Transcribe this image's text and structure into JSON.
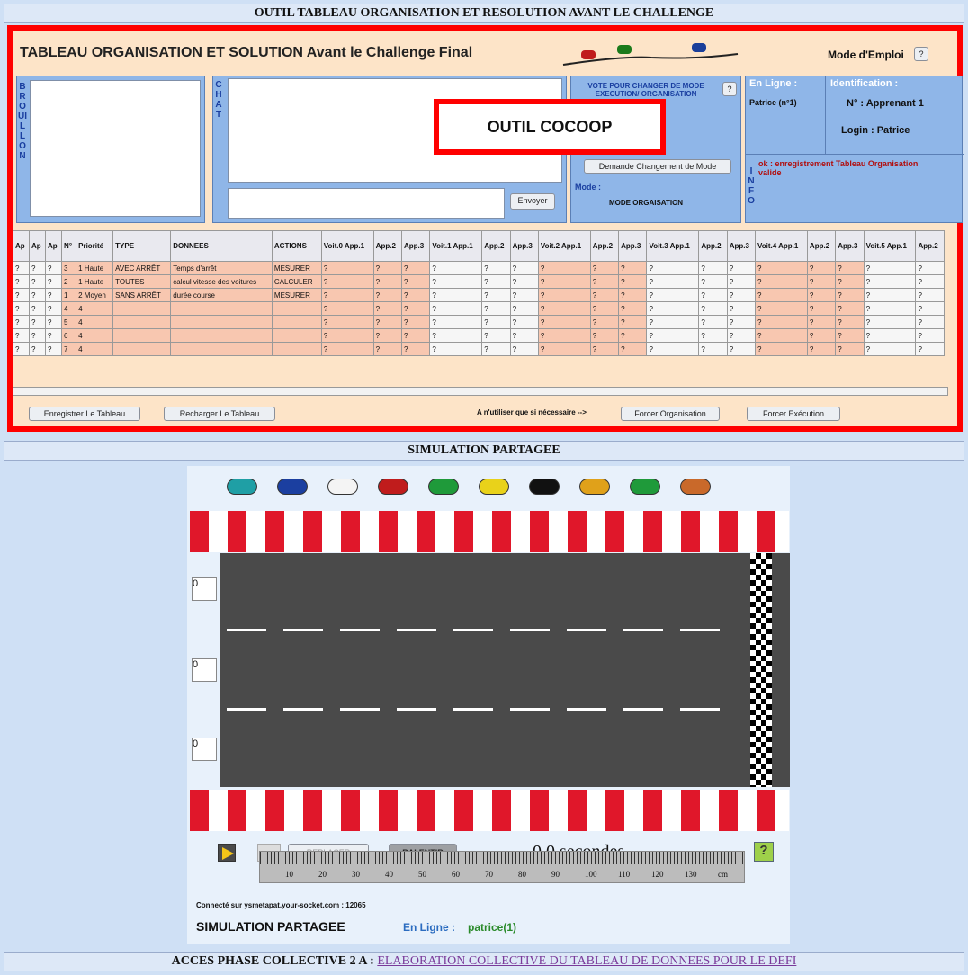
{
  "top_bar": "OUTIL TABLEAU ORGANISATION ET RESOLUTION AVANT LE CHALLENGE",
  "tool": {
    "title": "TABLEAU ORGANISATION ET SOLUTION Avant le Challenge Final",
    "mode_emploi": "Mode d'Emploi",
    "help": "?",
    "brouillon": "BROUILLON",
    "chat": "CHAT",
    "send": "Envoyer",
    "vote_title": "VOTE POUR CHANGER DE MODE EXECUTION/ ORGANISATION",
    "demande": "Demande Changement de Mode",
    "mode_label": "Mode :",
    "mode_value": "MODE ORGAISATION",
    "online_label": "En Ligne :",
    "online_user": "Patrice (n°1)",
    "ident_label": "Identification :",
    "learner": "N° : Apprenant 1",
    "login": "Login : Patrice",
    "info": "INFO",
    "info_msg": "ok : enregistrement Tableau Organisation valide",
    "overlay": "OUTIL COCOOP",
    "btn_save": "Enregistrer Le Tableau",
    "btn_reload": "Recharger Le Tableau",
    "note": "A n'utiliser que si nécessaire -->",
    "btn_force_org": "Forcer Organisation",
    "btn_force_exec": "Forcer Exécution"
  },
  "table": {
    "head": [
      "Ap",
      "Ap",
      "Ap",
      "N°",
      "Priorité",
      "TYPE",
      "DONNEES",
      "ACTIONS",
      "Voit.0 App.1",
      "App.2",
      "App.3",
      "Voit.1 App.1",
      "App.2",
      "App.3",
      "Voit.2 App.1",
      "App.2",
      "App.3",
      "Voit.3 App.1",
      "App.2",
      "App.3",
      "Voit.4 App.1",
      "App.2",
      "App.3",
      "Voit.5 App.1",
      "App.2"
    ],
    "rows": [
      [
        "?",
        "?",
        "?",
        "3",
        "1 Haute",
        "AVEC ARRÊT",
        "Temps d'arrêt",
        "MESURER"
      ],
      [
        "?",
        "?",
        "?",
        "2",
        "1 Haute",
        "TOUTES",
        "calcul vitesse des voitures",
        "CALCULER"
      ],
      [
        "?",
        "?",
        "?",
        "1",
        "2 Moyen",
        "SANS ARRÊT",
        "durée course",
        "MESURER"
      ],
      [
        "?",
        "?",
        "?",
        "4",
        "4",
        "",
        "",
        ""
      ],
      [
        "?",
        "?",
        "?",
        "5",
        "4",
        "",
        "",
        ""
      ],
      [
        "?",
        "?",
        "?",
        "6",
        "4",
        "",
        "",
        ""
      ],
      [
        "?",
        "?",
        "?",
        "7",
        "4",
        "",
        "",
        ""
      ]
    ]
  },
  "sim_bar": "SIMULATION PARTAGEE",
  "sim": {
    "replacer": "REPLACER",
    "ralentir": "RALENTIR",
    "time": "0.0 secondes",
    "help": "?",
    "lane_values": [
      "0",
      "0",
      "0"
    ],
    "ruler": [
      "10",
      "20",
      "30",
      "40",
      "50",
      "60",
      "70",
      "80",
      "90",
      "100",
      "110",
      "120",
      "130",
      "cm"
    ],
    "connected": "Connecté sur ysmetapat.your-socket.com : 12065",
    "title": "SIMULATION PARTAGEE",
    "online_label": "En Ligne :",
    "online_user": "patrice(1)"
  },
  "bottom": {
    "label": "ACCES PHASE COLLECTIVE 2 A :",
    "link": "ELABORATION COLLECTIVE DU TABLEAU DE DONNEES POUR LE DEFI"
  },
  "colors": {
    "red_frame": "#ff0000",
    "panel_blue": "#8fb6e8",
    "peach": "#fde4c8"
  },
  "cars": [
    "teal",
    "blue",
    "white",
    "red",
    "green",
    "yellow",
    "black",
    "orange",
    "green",
    "brown"
  ]
}
